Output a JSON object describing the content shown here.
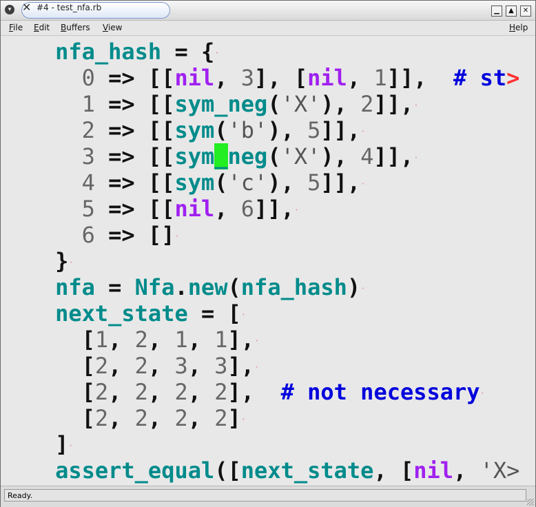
{
  "window": {
    "title": "#4 - test_nfa.rb"
  },
  "titlebar_buttons": {
    "minimize": "▁",
    "maximize": "▲",
    "close": "✕"
  },
  "menu": {
    "file": "File",
    "edit": "Edit",
    "buffers": "Buffers",
    "view": "View",
    "help": "Help"
  },
  "editor": {
    "lines": [
      "    nfa_hash = {",
      "      0 => [[nil, 3], [nil, 1]],  # st>",
      "      1 => [[sym_neg('X'), 2]],",
      "      2 => [[sym('b'), 5]],",
      "      3 => [[sym_neg('X'), 4]],",
      "      4 => [[sym('c'), 5]],",
      "      5 => [[nil, 6]],",
      "      6 => []",
      "    }",
      "    nfa = Nfa.new(nfa_hash)",
      "    next_state = [",
      "      [1, 2, 1, 1],",
      "      [2, 2, 3, 3],",
      "      [2, 2, 2, 2],  # not necessary",
      "      [2, 2, 2, 2]",
      "    ]",
      "    assert_equal([next_state, [nil, 'X>"
    ],
    "cursor": {
      "line": 4,
      "column": 16
    }
  },
  "status": {
    "text": "Ready."
  }
}
